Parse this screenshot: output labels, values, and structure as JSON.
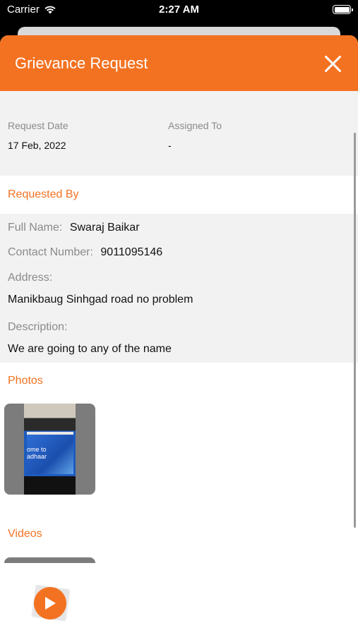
{
  "status_bar": {
    "carrier": "Carrier",
    "time": "2:27 AM",
    "wifi_icon": "wifi-icon",
    "battery_icon": "battery-icon"
  },
  "header": {
    "title": "Grievance Request",
    "close_icon": "close-icon",
    "background": "#F37221"
  },
  "request": {
    "date_label": "Request Date",
    "date_value": "17 Feb, 2022",
    "assigned_label": "Assigned To",
    "assigned_value": "-"
  },
  "requested_by": {
    "heading": "Requested By",
    "full_name_label": "Full Name:",
    "full_name_value": "Swaraj Baikar",
    "contact_label": "Contact Number:",
    "contact_value": "9011095146",
    "address_label": "Address:",
    "address_value": "Manikbaug Sinhgad road no problem",
    "description_label": "Description:",
    "description_value": "We are going to any of the name"
  },
  "photos": {
    "heading": "Photos",
    "thumbnail_text": "ome to\nadhaar"
  },
  "videos": {
    "heading": "Videos",
    "play_icon": "play-icon"
  },
  "colors": {
    "accent": "#F37221",
    "section_bg": "#f2f2f2"
  }
}
